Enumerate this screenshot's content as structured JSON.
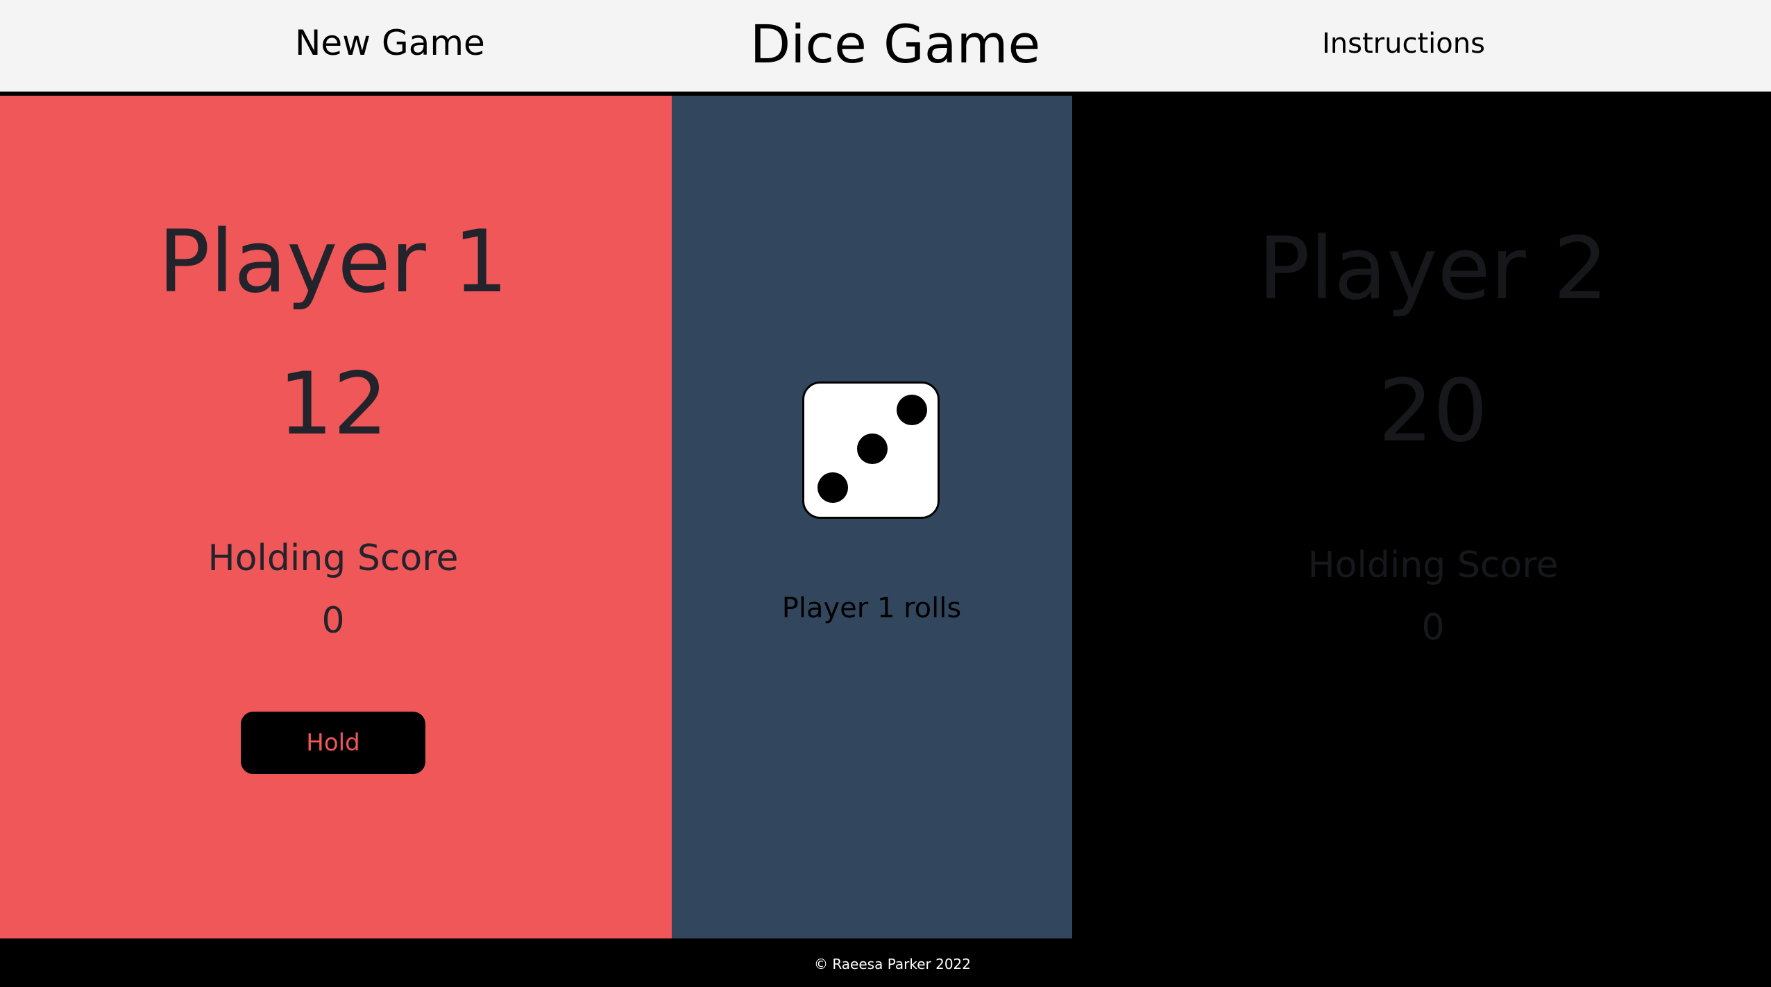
{
  "header": {
    "title": "Dice Game",
    "new_game_label": "New Game",
    "instructions_label": "Instructions"
  },
  "player1": {
    "name": "Player 1",
    "score": "12",
    "holding_label": "Holding Score",
    "holding_value": "0",
    "hold_button_label": "Hold",
    "active": true
  },
  "middle": {
    "dice_value": 3,
    "status_text": "Player 1 rolls"
  },
  "player2": {
    "name": "Player 2",
    "score": "20",
    "holding_label": "Holding Score",
    "holding_value": "0",
    "active": false
  },
  "footer": {
    "copyright": "© Raeesa Parker 2022"
  },
  "colors": {
    "player1_panel": "#ef5759",
    "middle_panel": "#32475e",
    "player2_panel": "#000000",
    "header_bg": "#f4f4f4"
  }
}
